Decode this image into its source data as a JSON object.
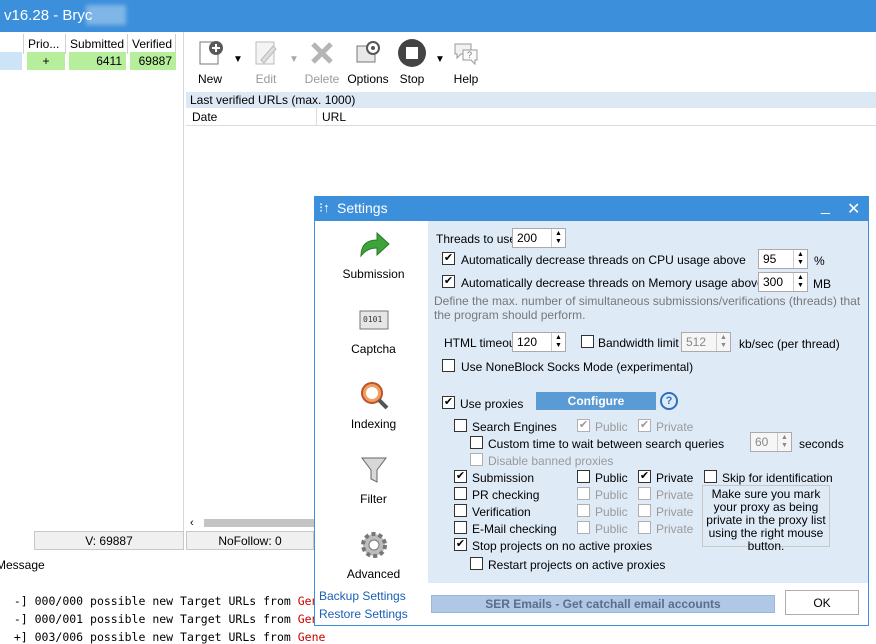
{
  "app": {
    "title": "v16.28 - Bryc"
  },
  "left_grid": {
    "columns": [
      "Prio...",
      "Submitted",
      "Verified"
    ],
    "row": {
      "prio": "+",
      "submitted": "6411",
      "verified": "69887"
    }
  },
  "toolbar": {
    "new": "New",
    "edit": "Edit",
    "delete": "Delete",
    "options": "Options",
    "stop": "Stop",
    "help": "Help"
  },
  "verified_panel": {
    "title": "Last verified URLs (max. 1000)",
    "columns": [
      "Date",
      "URL"
    ]
  },
  "status_bar": {
    "verified": "V: 69887",
    "nofollow": "NoFollow: 0"
  },
  "log": {
    "header": "Message",
    "lines": [
      {
        "prefix": "-] 000/000 possible new Target URLs from ",
        "tail": "Gene"
      },
      {
        "prefix": "-] 000/001 possible new Target URLs from ",
        "tail": "Gene"
      },
      {
        "prefix": "+] 003/006 possible new Target URLs from ",
        "tail": "Gene"
      }
    ]
  },
  "settings": {
    "title": "Settings",
    "sidebar": [
      "Submission",
      "Captcha",
      "Indexing",
      "Filter",
      "Advanced"
    ],
    "threads_label": "Threads to use",
    "threads_value": "200",
    "cpu_label": "Automatically decrease threads on CPU usage above",
    "cpu_value": "95",
    "cpu_unit": "%",
    "mem_label": "Automatically decrease threads on Memory usage above",
    "mem_value": "300",
    "mem_unit": "MB",
    "threads_note": "Define the max. number of simultaneous submissions/verifications (threads) that the program should perform.",
    "html_timeout_label": "HTML timeout",
    "html_timeout_value": "120",
    "bandwidth_label": "Bandwidth limit",
    "bandwidth_value": "512",
    "bandwidth_unit": "kb/sec (per thread)",
    "noneblock_label": "Use NoneBlock Socks Mode (experimental)",
    "use_proxies_label": "Use proxies",
    "configure_label": "Configure",
    "help_glyph": "?",
    "search_engines_label": "Search Engines",
    "public_label": "Public",
    "private_label": "Private",
    "custom_time_label": "Custom time to wait between search queries",
    "custom_time_value": "60",
    "seconds_label": "seconds",
    "disable_banned_label": "Disable banned proxies",
    "submission_label": "Submission",
    "pr_checking_label": "PR checking",
    "verification_label": "Verification",
    "email_checking_label": "E-Mail checking",
    "skip_identification_label": "Skip for identification",
    "proxy_note": "Make sure you mark your proxy as being private in the proxy list using the right mouse button.",
    "stop_projects_label": "Stop projects on no active proxies",
    "restart_projects_label": "Restart projects on active proxies",
    "backup_label": "Backup Settings",
    "restore_label": "Restore Settings",
    "ser_emails_label": "SER Emails - Get catchall email accounts",
    "ok_label": "OK"
  }
}
